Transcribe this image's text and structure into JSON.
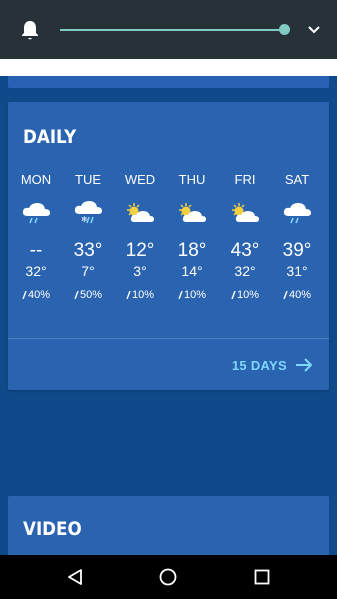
{
  "notification": {
    "bell_icon": "bell-icon",
    "brightness_level": 0.96,
    "expand_icon": "chevron-down-icon"
  },
  "daily": {
    "title": "DAILY",
    "days": [
      {
        "name": "MON",
        "icon": "cloud-rain",
        "high": "--",
        "low": "32°",
        "precip": "40%"
      },
      {
        "name": "TUE",
        "icon": "cloud-snow-rain",
        "high": "33°",
        "low": "7°",
        "precip": "50%"
      },
      {
        "name": "WED",
        "icon": "partly-sunny",
        "high": "12°",
        "low": "3°",
        "precip": "10%"
      },
      {
        "name": "THU",
        "icon": "partly-sunny",
        "high": "18°",
        "low": "14°",
        "precip": "10%"
      },
      {
        "name": "FRI",
        "icon": "partly-sunny",
        "high": "43°",
        "low": "32°",
        "precip": "10%"
      },
      {
        "name": "SAT",
        "icon": "cloud-rain",
        "high": "39°",
        "low": "31°",
        "precip": "40%"
      }
    ],
    "more_link": "15 DAYS"
  },
  "video": {
    "title": "VIDEO"
  },
  "navbar": {
    "back": "back-icon",
    "home": "home-icon",
    "recents": "recents-icon"
  },
  "colors": {
    "background": "#0f4a8a",
    "card": "#2a63b0",
    "link": "#7fd6ff",
    "slider": "#80cbc4",
    "shade": "#263238"
  }
}
